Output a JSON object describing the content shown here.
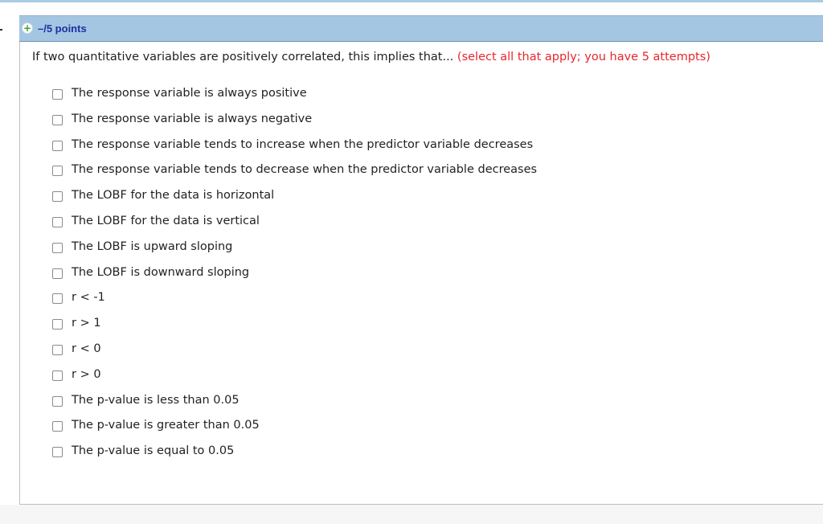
{
  "header": {
    "points_label": "–/5 points",
    "expand_symbol": "+"
  },
  "question": {
    "prompt": "If two quantitative variables are positively correlated, this implies that... ",
    "instruction": "(select all that apply; you have 5 attempts)"
  },
  "options": [
    "The response variable is always positive",
    "The response variable is always negative",
    "The response variable tends to increase when the predictor variable decreases",
    "The response variable tends to decrease when the predictor variable decreases",
    "The LOBF for the data is horizontal",
    "The LOBF for the data is vertical",
    "The LOBF is upward sloping",
    "The LOBF is downward sloping",
    "r < -1",
    "r > 1",
    "r < 0",
    "r > 0",
    "The p-value is less than 0.05",
    "The p-value is greater than 0.05",
    "The p-value is equal to 0.05"
  ],
  "colors": {
    "header_bg": "#a4c6e2",
    "points_text": "#1d2f9f",
    "instruction_text": "#e8262d",
    "expand_icon": "#3aa33a"
  },
  "icons": {
    "expand": "plus-circle-icon",
    "option_box": "checkbox"
  }
}
